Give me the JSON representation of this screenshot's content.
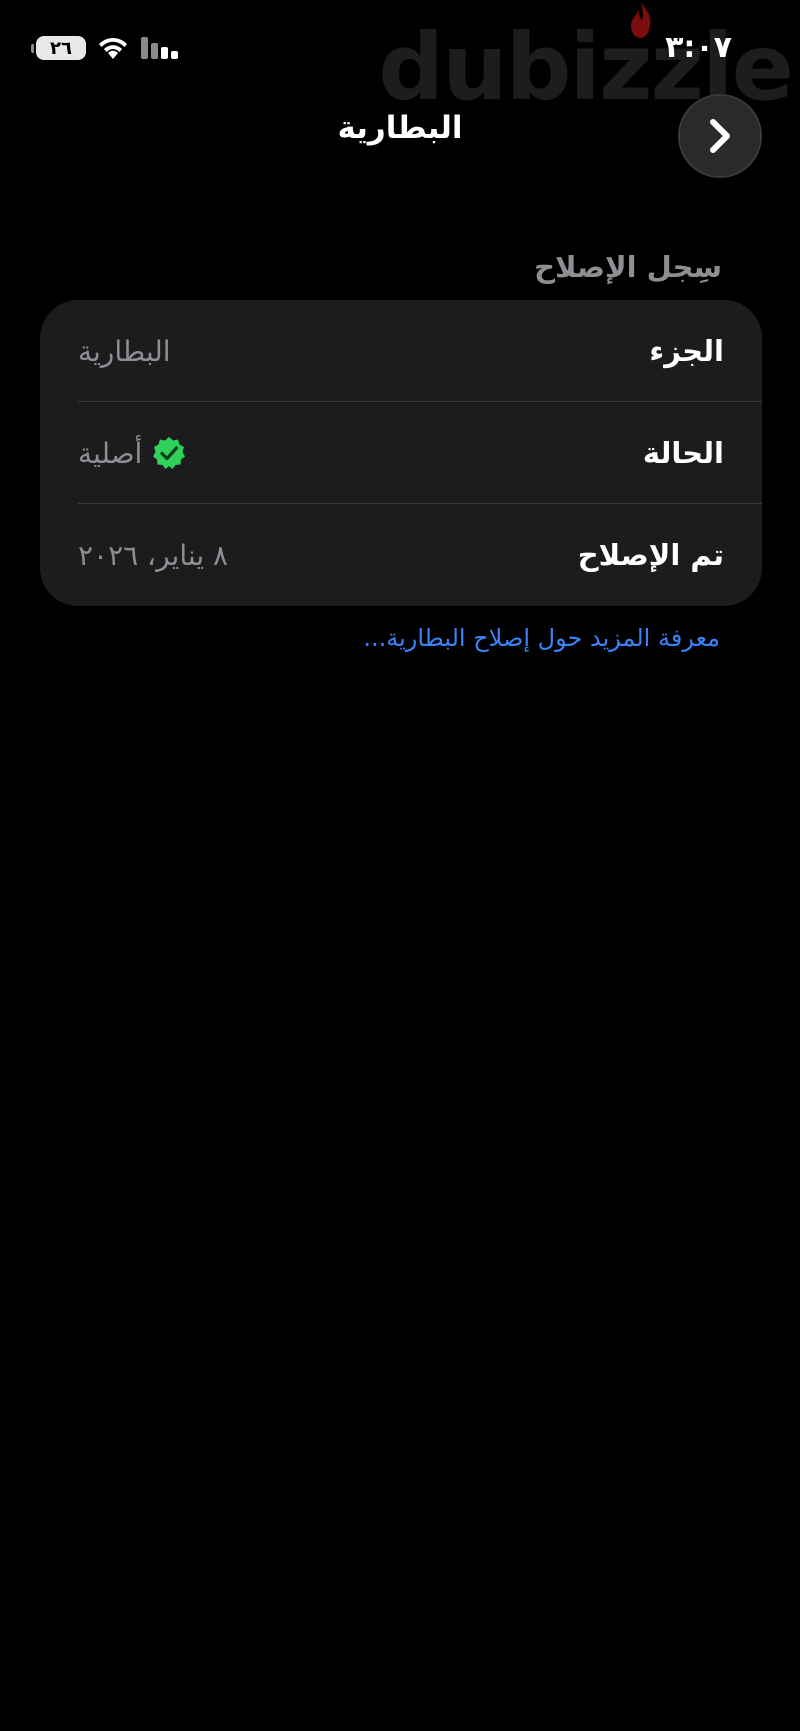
{
  "watermark": {
    "text": "dubizzle"
  },
  "status_bar": {
    "time": "٣:٠٧",
    "battery_level": "٢٦",
    "icons": [
      "battery-icon",
      "wifi-icon",
      "cellular-signal-icon"
    ]
  },
  "nav": {
    "title": "البطارية",
    "back_icon": "chevron-right-icon"
  },
  "repair_history": {
    "header": "سِجل الإصلاح",
    "rows": [
      {
        "label": "الجزء",
        "value": "البطارية"
      },
      {
        "label": "الحالة",
        "value": "أصلية",
        "icon": "verified-check-icon"
      },
      {
        "label": "تم الإصلاح",
        "value": "٨ يناير، ٢٠٢٦"
      }
    ],
    "learn_more_link": "معرفة المزيد حول إصلاح البطارية..."
  },
  "colors": {
    "background": "#000000",
    "card": "#1c1c1e",
    "secondary_text": "#8e8e93",
    "link": "#3b82f6",
    "verified_green": "#30d158"
  }
}
